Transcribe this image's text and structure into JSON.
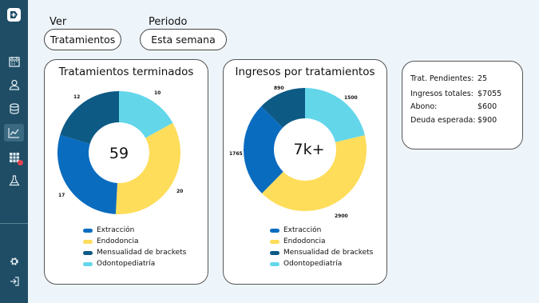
{
  "colors": {
    "sidebar": "#1f4d66",
    "extraccion": "#0a6cbf",
    "endodoncia": "#fedd5b",
    "mensualidad": "#0d5a85",
    "odontopediatria": "#63d6ea"
  },
  "sidebar": {
    "icons": [
      "logo-icon",
      "calendar-icon",
      "user-icon",
      "database-icon",
      "chart-icon",
      "table-icon",
      "flask-icon",
      "gear-icon",
      "logout-icon"
    ]
  },
  "filters": {
    "ver_label": "Ver",
    "ver_value": "Tratamientos",
    "periodo_label": "Periodo",
    "periodo_value": "Esta semana"
  },
  "legend": [
    "Extracción",
    "Endodoncia",
    "Mensualidad de brackets",
    "Odontopediatría"
  ],
  "chart_data": [
    {
      "type": "pie",
      "title": "Tratamientos terminados",
      "center_value": "59",
      "categories": [
        "Odontopediatría",
        "Endodoncia",
        "Extracción",
        "Mensualidad de brackets"
      ],
      "values": [
        10,
        20,
        17,
        12
      ]
    },
    {
      "type": "pie",
      "title": "Ingresos por tratamientos",
      "center_value": "7k+",
      "categories": [
        "Odontopediatría",
        "Endodoncia",
        "Extracción",
        "Mensualidad de brackets"
      ],
      "values": [
        1500,
        2900,
        1765,
        890
      ]
    }
  ],
  "summary": {
    "pendientes_label": "Trat. Pendientes:",
    "pendientes_value": "25",
    "ingresos_label": "Ingresos totales:",
    "ingresos_value": "$7055",
    "abono_label": "Abono:",
    "abono_value": "$600",
    "deuda_label": "Deuda esperada:",
    "deuda_value": "$900"
  }
}
